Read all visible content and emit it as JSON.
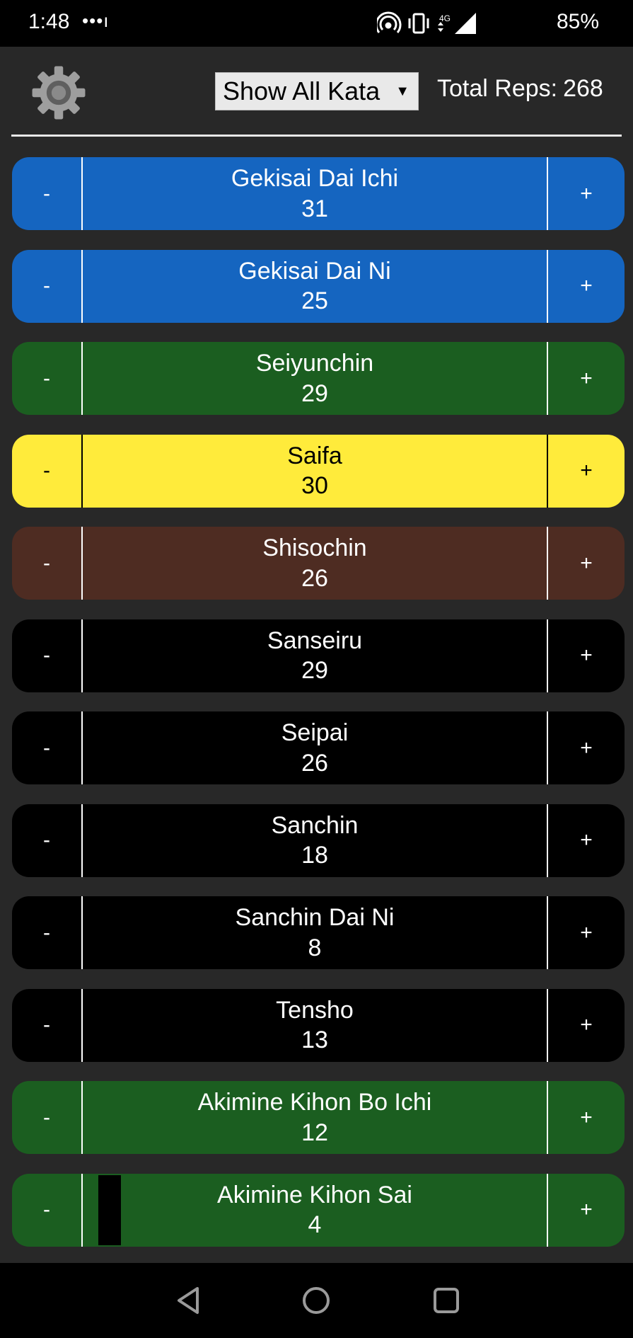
{
  "status_bar": {
    "time": "1:48",
    "dots": "•••ı",
    "battery": "85%",
    "icons": [
      "hotspot-icon",
      "vibrate-icon",
      "4g-icon",
      "signal-icon"
    ]
  },
  "header": {
    "settings_icon": "gear-icon",
    "filter": {
      "selected": "Show All Kata"
    },
    "total_label": "Total Reps:",
    "total_value": "268"
  },
  "colors": {
    "blue": "#1565c0",
    "green": "#1b5e20",
    "yellow": "#ffeb3b",
    "brown": "#4e2c22",
    "black": "#000000",
    "background": "#282828"
  },
  "kata": [
    {
      "name": "Gekisai Dai Ichi",
      "count": "31",
      "color": "blue",
      "minus": "-",
      "plus": "+"
    },
    {
      "name": "Gekisai Dai Ni",
      "count": "25",
      "color": "blue",
      "minus": "-",
      "plus": "+"
    },
    {
      "name": "Seiyunchin",
      "count": "29",
      "color": "green",
      "minus": "-",
      "plus": "+"
    },
    {
      "name": "Saifa",
      "count": "30",
      "color": "yellow",
      "minus": "-",
      "plus": "+"
    },
    {
      "name": "Shisochin",
      "count": "26",
      "color": "brown",
      "minus": "-",
      "plus": "+"
    },
    {
      "name": "Sanseiru",
      "count": "29",
      "color": "black",
      "minus": "-",
      "plus": "+"
    },
    {
      "name": "Seipai",
      "count": "26",
      "color": "black",
      "minus": "-",
      "plus": "+"
    },
    {
      "name": "Sanchin",
      "count": "18",
      "color": "black",
      "minus": "-",
      "plus": "+"
    },
    {
      "name": "Sanchin Dai Ni",
      "count": "8",
      "color": "black",
      "minus": "-",
      "plus": "+"
    },
    {
      "name": "Tensho",
      "count": "13",
      "color": "black",
      "minus": "-",
      "plus": "+"
    },
    {
      "name": "Akimine Kihon Bo Ichi",
      "count": "12",
      "color": "green",
      "minus": "-",
      "plus": "+"
    },
    {
      "name": "Akimine Kihon Sai",
      "count": "4",
      "color": "green",
      "minus": "-",
      "plus": "+",
      "has_marker": true
    }
  ],
  "nav_bar": {
    "buttons": [
      "back-icon",
      "home-icon",
      "recents-icon"
    ]
  }
}
